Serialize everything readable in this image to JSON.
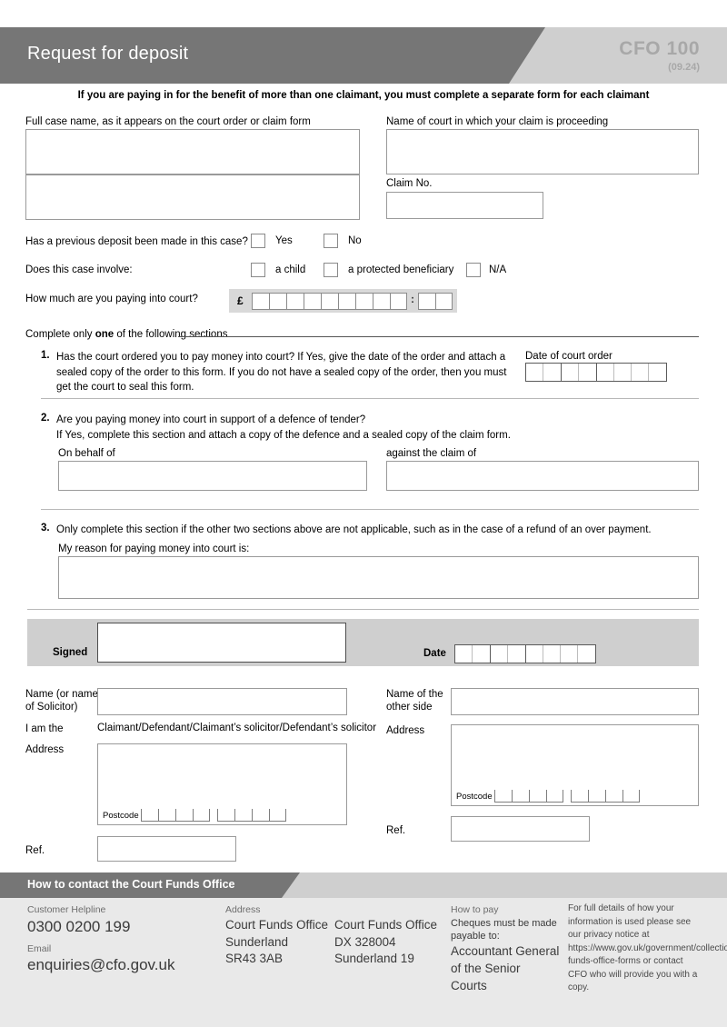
{
  "header": {
    "title": "Request for deposit",
    "form_code": "CFO 100",
    "version": "(09.24)"
  },
  "notice": "If you are paying in for the benefit of more than one claimant,  you must complete a separate form for each claimant",
  "case": {
    "full_case_name_label": "Full case name, as it appears on the court order or claim form",
    "court_name_label": "Name of court in which your claim is proceeding",
    "claim_no_label": "Claim No.",
    "full_case_name_value": "",
    "full_case_name_value2": "",
    "court_name_value": "",
    "claim_no_value": ""
  },
  "questions": {
    "previous_deposit_label": "Has a previous deposit been made in this case?",
    "yes_label": "Yes",
    "no_label": "No",
    "case_involve_label": "Does this case involve:",
    "a_child_label": "a child",
    "protected_beneficiary_label": "a protected beneficiary",
    "na_label": "N/A",
    "amount_label": "How much are you paying into court?",
    "currency_symbol": "£",
    "decimal_separator": ":"
  },
  "sections": {
    "heading_pre": "Complete only ",
    "heading_bold": "one",
    "heading_post": " of the following sections",
    "s1": {
      "number": "1.",
      "line1": "Has the court ordered you to pay money into court? If Yes, give the date of the order and attach a sealed copy of",
      "line2": "the order to this form. If you do not have a sealed copy of the order, then you must get the court to seal this form.",
      "date_label": "Date of court order"
    },
    "s2": {
      "number": "2.",
      "line1": "Are you paying money into court in support of a defence of tender?",
      "line2": "If Yes, complete this section and attach a copy of the defence and a sealed copy of the claim form.",
      "on_behalf_of_label": "On behalf of",
      "against_claim_of_label": "against the claim of",
      "on_behalf_of_value": "",
      "against_claim_of_value": ""
    },
    "s3": {
      "number": "3.",
      "line1": "Only complete this section if the other two sections above are not applicable, such as in the case of a refund of an over payment.",
      "reason_label": "My reason for paying money into court is:",
      "reason_value": ""
    }
  },
  "signature": {
    "signed_label": "Signed",
    "date_label": "Date",
    "signed_value": ""
  },
  "applicant": {
    "name_label_line1": "Name (or name",
    "name_label_line2": "of Solicitor)",
    "name_value": "",
    "i_am_the_label": "I am the",
    "i_am_the_options": "Claimant/Defendant/Claimant’s solicitor/Defendant’s solicitor",
    "address_label": "Address",
    "address_value": "",
    "postcode_label": "Postcode",
    "ref_label": "Ref.",
    "ref_value": ""
  },
  "other_side": {
    "name_label_line1": "Name of the",
    "name_label_line2": "other side",
    "name_value": "",
    "address_label": "Address",
    "address_value": "",
    "postcode_label": "Postcode",
    "ref_label": "Ref.",
    "ref_value": ""
  },
  "footer": {
    "title": "How to contact the Court Funds Office",
    "helpline_label": "Customer Helpline",
    "helpline_value": "0300 0200 199",
    "email_label": "Email",
    "email_value": "enquiries@cfo.gov.uk",
    "address_label": "Address",
    "address_line1": "Court Funds Office",
    "address_line2": "Sunderland",
    "address_line3": "SR43 3AB",
    "dx_line1": "Court Funds Office",
    "dx_line2": "DX 328004",
    "dx_line3": "Sunderland 19",
    "how_to_pay_label": "How to pay",
    "how_to_pay_line1": "Cheques must be made",
    "how_to_pay_line2": "payable to:",
    "payee_line1": "Accountant General",
    "payee_line2": "of the Senior Courts",
    "privacy_text": "For full details of how your information is used please see our privacy notice at https://www.gov.uk/government/collections/court-funds-office-forms or contact CFO who will provide you with a copy."
  },
  "colors": {
    "header_dark": "#767676",
    "header_light": "#cfcfcf",
    "band_grey": "#d9d9d9",
    "footer_bg": "#e9e9e9"
  }
}
